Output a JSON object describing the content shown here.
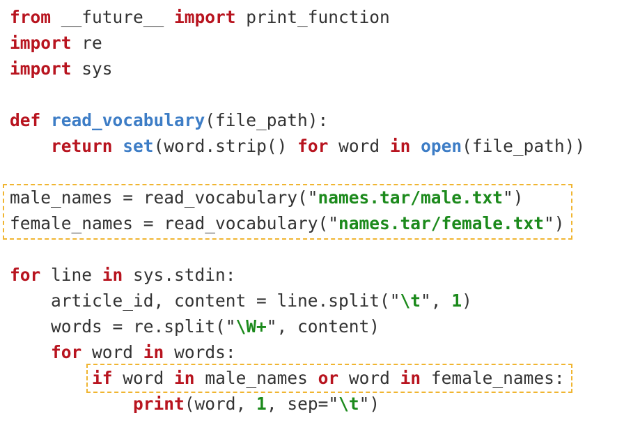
{
  "colors": {
    "keyword": "#b8141f",
    "function": "#3d7dc6",
    "string_bold": "#1c8a1c",
    "plain": "#333333",
    "highlight_box": "#f0b531"
  },
  "code": {
    "l1": {
      "a": "from",
      "b": " __future__ ",
      "c": "import",
      "d": " print_function"
    },
    "l2": {
      "a": "import",
      "b": " re"
    },
    "l3": {
      "a": "import",
      "b": " sys"
    },
    "l5": {
      "a": "def",
      "b": " ",
      "c": "read_vocabulary",
      "d": "(file_path):"
    },
    "l6": {
      "ind": "    ",
      "a": "return",
      "b": " ",
      "c": "set",
      "d": "(word.strip() ",
      "e": "for",
      "f": " word ",
      "g": "in",
      "h": " ",
      "i": "open",
      "j": "(file_path))"
    },
    "l8": {
      "a": "male_names = read_vocabulary(\"",
      "b": "names.tar/male.txt",
      "c": "\")"
    },
    "l9": {
      "a": "female_names = read_vocabulary(\"",
      "b": "names.tar/female.txt",
      "c": "\")"
    },
    "l11": {
      "a": "for",
      "b": " line ",
      "c": "in",
      "d": " sys.stdin:"
    },
    "l12": {
      "ind": "    ",
      "a": "article_id, content = line.split(\"",
      "b": "\\t",
      "c": "\", ",
      "d": "1",
      "e": ")"
    },
    "l13": {
      "ind": "    ",
      "a": "words = re.split(\"",
      "b": "\\W+",
      "c": "\", content)"
    },
    "l14": {
      "ind": "    ",
      "a": "for",
      "b": " word ",
      "c": "in",
      "d": " words:"
    },
    "l15": {
      "ind": "        ",
      "a": "if",
      "b": " word ",
      "c": "in",
      "d": " male_names ",
      "e": "or",
      "f": " word ",
      "g": "in",
      "h": " female_names:"
    },
    "l16": {
      "ind": "            ",
      "a": "print",
      "b": "(word, ",
      "c": "1",
      "d": ", sep=\"",
      "e": "\\t",
      "f": "\")"
    }
  }
}
